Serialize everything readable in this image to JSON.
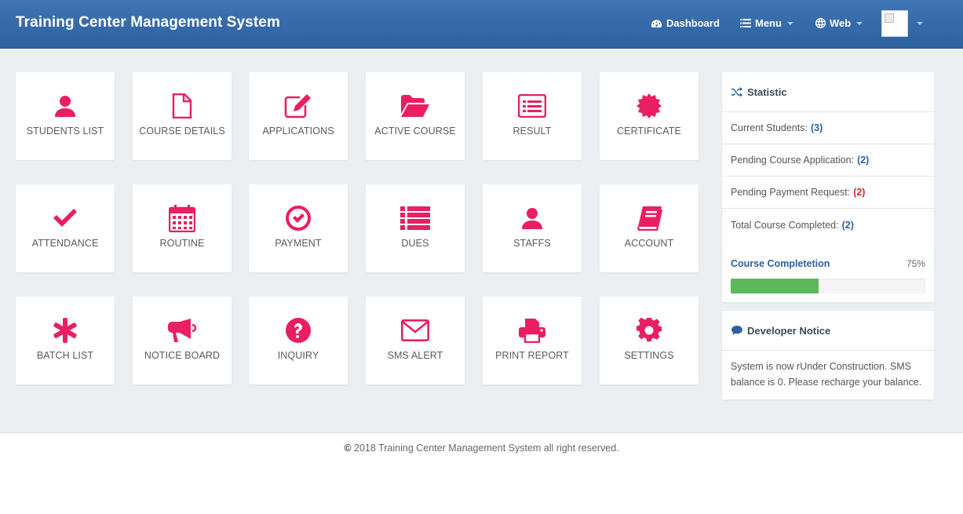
{
  "header": {
    "brand": "Training Center Management System",
    "nav": [
      {
        "label": "Dashboard",
        "icon": "dashboard-icon"
      },
      {
        "label": "Menu",
        "icon": "list-icon"
      },
      {
        "label": "Web",
        "icon": "globe-icon"
      }
    ]
  },
  "tiles": [
    {
      "label": "STUDENTS LIST",
      "icon": "user-icon"
    },
    {
      "label": "COURSE DETAILS",
      "icon": "file-icon"
    },
    {
      "label": "APPLICATIONS",
      "icon": "edit-icon"
    },
    {
      "label": "ACTIVE COURSE",
      "icon": "folder-open-icon"
    },
    {
      "label": "RESULT",
      "icon": "list-alt-icon"
    },
    {
      "label": "CERTIFICATE",
      "icon": "certificate-icon"
    },
    {
      "label": "ATTENDANCE",
      "icon": "check-icon"
    },
    {
      "label": "ROUTINE",
      "icon": "calendar-icon"
    },
    {
      "label": "PAYMENT",
      "icon": "check-circle-icon"
    },
    {
      "label": "DUES",
      "icon": "list-icon"
    },
    {
      "label": "STAFFS",
      "icon": "user-icon"
    },
    {
      "label": "ACCOUNT",
      "icon": "book-icon"
    },
    {
      "label": "BATCH LIST",
      "icon": "asterisk-icon"
    },
    {
      "label": "NOTICE BOARD",
      "icon": "bullhorn-icon"
    },
    {
      "label": "INQUIRY",
      "icon": "question-circle-icon"
    },
    {
      "label": "SMS ALERT",
      "icon": "envelope-icon"
    },
    {
      "label": "PRINT REPORT",
      "icon": "print-icon"
    },
    {
      "label": "SETTINGS",
      "icon": "gear-icon"
    }
  ],
  "statistic": {
    "title": "Statistic",
    "rows": [
      {
        "label": "Current Students:",
        "value": "(3)",
        "color": "#2d609e"
      },
      {
        "label": "Pending Course Application:",
        "value": "(2)",
        "color": "#2d609e"
      },
      {
        "label": "Pending Payment Request:",
        "value": "(2)",
        "color": "#d9232e"
      },
      {
        "label": "Total Course Completed:",
        "value": "(2)",
        "color": "#2d609e"
      }
    ]
  },
  "completion": {
    "title": "Course Completetion",
    "percent_label": "75%",
    "fraction": 0.45
  },
  "notice": {
    "title": "Developer Notice",
    "body": "System is now rUnder Construction. SMS balance is 0. Please recharge your balance."
  },
  "footer": {
    "copyright_symbol": "©",
    "text": "2018 Training Center Management System all right reserved."
  },
  "colors": {
    "accent": "#e91e63",
    "navbar": "#3a6dab",
    "progress": "#5cb85c"
  }
}
